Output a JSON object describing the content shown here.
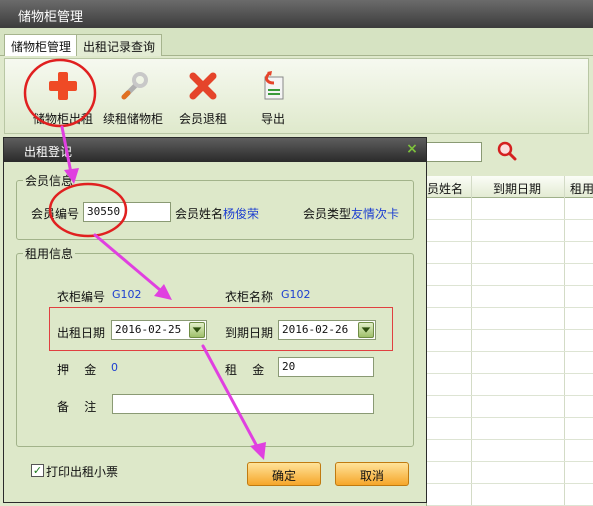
{
  "window": {
    "title": "储物柜管理"
  },
  "tabs": [
    {
      "label": "储物柜管理",
      "active": true
    },
    {
      "label": "出租记录查询",
      "active": false
    }
  ],
  "toolbar": {
    "items": [
      {
        "label": "储物柜出租",
        "icon": "plus-icon"
      },
      {
        "label": "续租储物柜",
        "icon": "wrench-icon"
      },
      {
        "label": "会员退租",
        "icon": "x-icon"
      },
      {
        "label": "导出",
        "icon": "export-icon"
      }
    ]
  },
  "grid": {
    "columns": [
      "员姓名",
      "到期日期",
      "租用"
    ]
  },
  "dialog": {
    "title": "出租登记",
    "close": "×",
    "member_group": {
      "title": "会员信息",
      "member_no_label": "会员编号",
      "member_no_value": "30550",
      "member_name_label": "会员姓名",
      "member_name_value": "杨俊荣",
      "member_type_label": "会员类型",
      "member_type_value": "友情次卡"
    },
    "rent_group": {
      "title": "租用信息",
      "locker_no_label": "衣柜编号",
      "locker_no_value": "G102",
      "locker_name_label": "衣柜名称",
      "locker_name_value": "G102",
      "rent_date_label": "出租日期",
      "rent_date_value": "2016-02-25",
      "due_date_label": "到期日期",
      "due_date_value": "2016-02-26",
      "deposit_label": "押    金",
      "deposit_value": "0",
      "rent_label": "租    金",
      "rent_value": "20",
      "remark_label": "备    注",
      "remark_value": ""
    },
    "print_label": "打印出租小票",
    "print_checked": true,
    "confirm_label": "确定",
    "cancel_label": "取消"
  },
  "colors": {
    "accent": "#f6a62a",
    "annotation": "#e040e0",
    "highlight": "#e02020"
  }
}
